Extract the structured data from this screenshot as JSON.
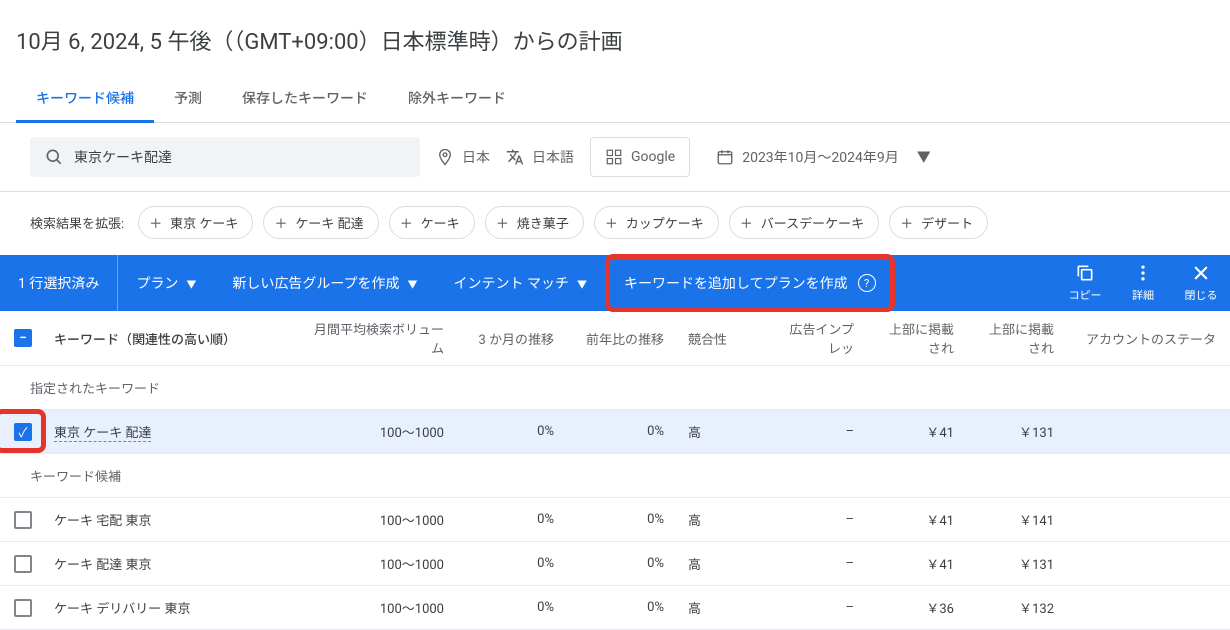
{
  "page_title": "10月 6, 2024, 5 午後（（GMT+09:00）日本標準時）からの計画",
  "tabs": [
    "キーワード候補",
    "予測",
    "保存したキーワード",
    "除外キーワード"
  ],
  "active_tab": 0,
  "filters": {
    "search_text": "東京ケーキ配達",
    "location": "日本",
    "language": "日本語",
    "network": "Google",
    "date_range": "2023年10月～2024年9月"
  },
  "expand": {
    "label": "検索結果を拡張:",
    "chips": [
      "東京 ケーキ",
      "ケーキ 配達",
      "ケーキ",
      "焼き菓子",
      "カップケーキ",
      "バースデーケーキ",
      "デザート"
    ]
  },
  "action_bar": {
    "selected_text": "1 行選択済み",
    "plan_dd": "プラン",
    "create_group": "新しい広告グループを作成",
    "intent_match": "インテント マッチ",
    "add_kw": "キーワードを追加してプランを作成",
    "copy": "コピー",
    "details": "詳細",
    "close": "閉じる"
  },
  "columns": {
    "keyword": "キーワード（関連性の高い順）",
    "volume": "月間平均検索ボリューム",
    "three_month": "3 か月の推移",
    "yoy": "前年比の推移",
    "competition": "競合性",
    "impressions": "広告インプレッ",
    "top_low": "上部に掲載され",
    "top_high": "上部に掲載され",
    "account": "アカウントのステータ"
  },
  "section_specified": "指定されたキーワード",
  "section_candidates": "キーワード候補",
  "rows_specified": [
    {
      "checked": true,
      "keyword": "東京 ケーキ 配達",
      "volume": "100～1000",
      "three_month": "0%",
      "yoy": "0%",
      "competition": "高",
      "impressions": "–",
      "top_low": "￥41",
      "top_high": "￥131"
    }
  ],
  "rows_candidates": [
    {
      "checked": false,
      "keyword": "ケーキ 宅配 東京",
      "volume": "100～1000",
      "three_month": "0%",
      "yoy": "0%",
      "competition": "高",
      "impressions": "–",
      "top_low": "￥41",
      "top_high": "￥141"
    },
    {
      "checked": false,
      "keyword": "ケーキ 配達 東京",
      "volume": "100～1000",
      "three_month": "0%",
      "yoy": "0%",
      "competition": "高",
      "impressions": "–",
      "top_low": "￥41",
      "top_high": "￥131"
    },
    {
      "checked": false,
      "keyword": "ケーキ デリバリー 東京",
      "volume": "100～1000",
      "three_month": "0%",
      "yoy": "0%",
      "competition": "高",
      "impressions": "–",
      "top_low": "￥36",
      "top_high": "￥132"
    }
  ]
}
